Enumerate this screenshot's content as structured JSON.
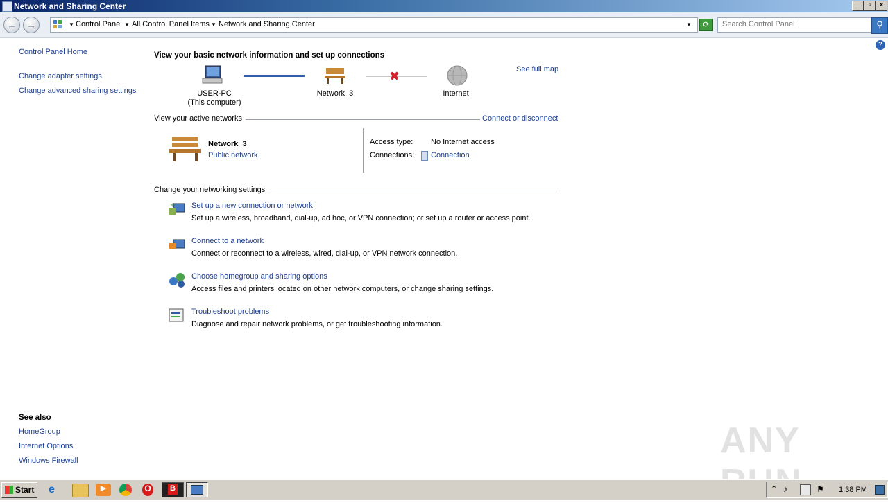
{
  "window": {
    "title": "Network and Sharing Center"
  },
  "address": {
    "crumbs": [
      "Control Panel",
      "All Control Panel Items",
      "Network and Sharing Center"
    ],
    "search_placeholder": "Search Control Panel"
  },
  "sidebar": {
    "home": "Control Panel Home",
    "links": [
      "Change adapter settings",
      "Change advanced sharing settings"
    ],
    "see_also_title": "See also",
    "see_also": [
      "HomeGroup",
      "Internet Options",
      "Windows Firewall"
    ]
  },
  "main": {
    "title": "View your basic network information and set up connections",
    "see_full_map": "See full map",
    "map": {
      "computer": "USER-PC",
      "computer_sub": "(This computer)",
      "network": "Network  3",
      "internet": "Internet"
    },
    "active": {
      "header": "View your active networks",
      "connect_link": "Connect or disconnect",
      "name": "Network  3",
      "type": "Public network",
      "access_label": "Access type:",
      "access_value": "No Internet access",
      "connections_label": "Connections:",
      "connections_value": "Connection"
    },
    "settings": {
      "header": "Change your networking settings",
      "items": [
        {
          "title": "Set up a new connection or network",
          "desc": "Set up a wireless, broadband, dial-up, ad hoc, or VPN connection; or set up a router or access point."
        },
        {
          "title": "Connect to a network",
          "desc": "Connect or reconnect to a wireless, wired, dial-up, or VPN network connection."
        },
        {
          "title": "Choose homegroup and sharing options",
          "desc": "Access files and printers located on other network computers, or change sharing settings."
        },
        {
          "title": "Troubleshoot problems",
          "desc": "Diagnose and repair network problems, or get troubleshooting information."
        }
      ]
    }
  },
  "taskbar": {
    "start": "Start",
    "time": "1:38 PM"
  },
  "watermark": "ANY RUN",
  "colors": {
    "link": "#1e3f91",
    "accent": "#3b78c4"
  }
}
